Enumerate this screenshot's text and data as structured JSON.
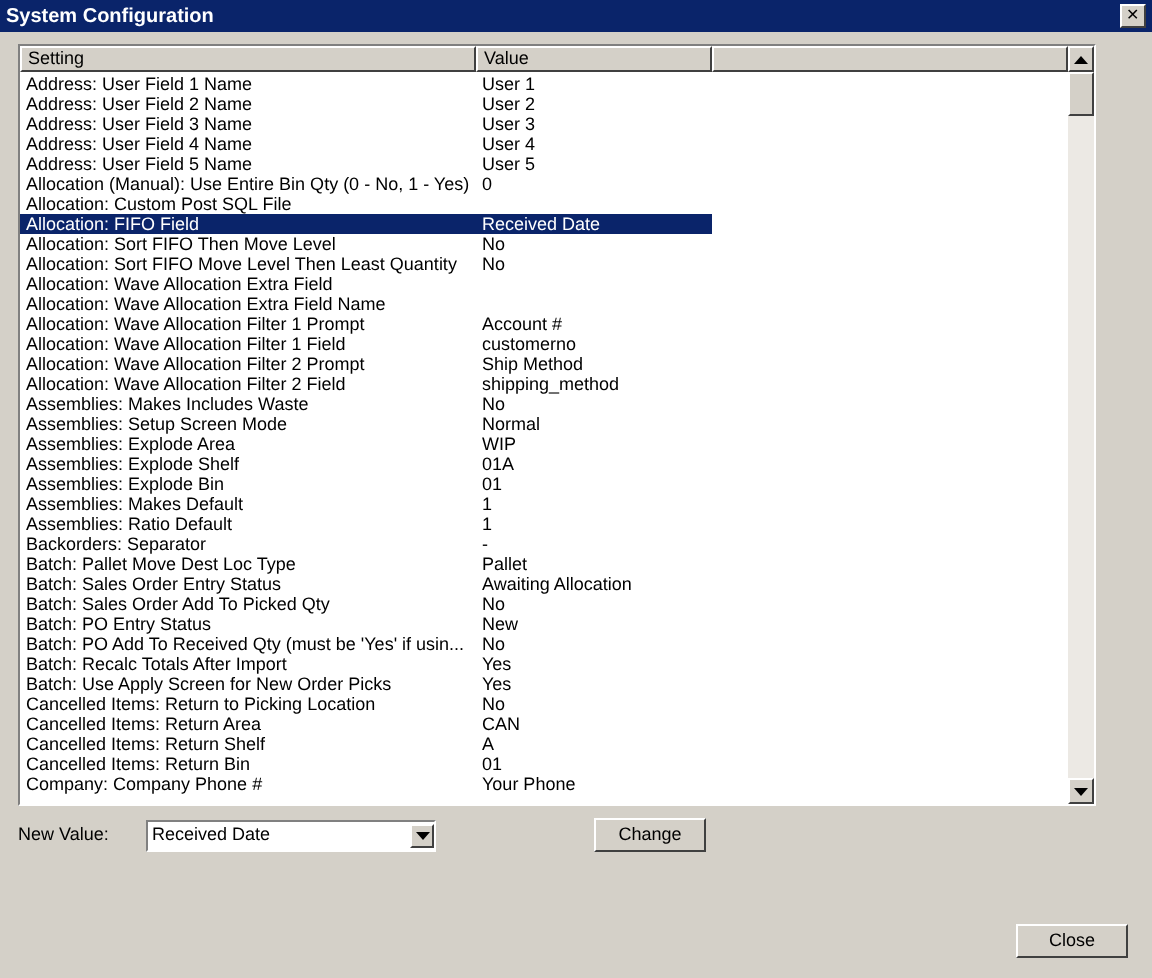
{
  "window": {
    "title": "System Configuration",
    "close": "✕"
  },
  "table": {
    "columns": [
      "Setting",
      "Value"
    ],
    "rows": [
      {
        "setting": "Address: User Field 1 Name",
        "value": "User 1",
        "selected": false
      },
      {
        "setting": "Address: User Field 2 Name",
        "value": "User 2",
        "selected": false
      },
      {
        "setting": "Address: User Field 3 Name",
        "value": "User 3",
        "selected": false
      },
      {
        "setting": "Address: User Field 4 Name",
        "value": "User 4",
        "selected": false
      },
      {
        "setting": "Address: User Field 5 Name",
        "value": "User 5",
        "selected": false
      },
      {
        "setting": "Allocation (Manual): Use Entire Bin Qty (0 - No, 1 - Yes)",
        "value": "0",
        "selected": false
      },
      {
        "setting": "Allocation: Custom Post SQL File",
        "selected": false
      },
      {
        "setting": "Allocation: FIFO Field",
        "value": "Received Date",
        "selected": true
      },
      {
        "setting": "Allocation: Sort FIFO Then Move Level",
        "value": "No",
        "selected": false
      },
      {
        "setting": "Allocation: Sort FIFO Move Level Then Least Quantity",
        "value": "No",
        "selected": false
      },
      {
        "setting": "Allocation: Wave Allocation Extra Field",
        "selected": false
      },
      {
        "setting": "Allocation: Wave Allocation Extra Field Name",
        "selected": false
      },
      {
        "setting": "Allocation: Wave Allocation Filter 1 Prompt",
        "value": "Account #",
        "selected": false
      },
      {
        "setting": "Allocation: Wave Allocation Filter 1 Field",
        "value": "customerno",
        "selected": false
      },
      {
        "setting": "Allocation: Wave Allocation Filter 2 Prompt",
        "value": "Ship Method",
        "selected": false
      },
      {
        "setting": "Allocation: Wave Allocation Filter 2 Field",
        "value": "shipping_method",
        "selected": false
      },
      {
        "setting": "Assemblies: Makes Includes Waste",
        "value": "No",
        "selected": false
      },
      {
        "setting": "Assemblies: Setup Screen Mode",
        "value": "Normal",
        "selected": false
      },
      {
        "setting": "Assemblies: Explode Area",
        "value": "WIP",
        "selected": false
      },
      {
        "setting": "Assemblies: Explode Shelf",
        "value": "01A",
        "selected": false
      },
      {
        "setting": "Assemblies: Explode Bin",
        "value": "01",
        "selected": false
      },
      {
        "setting": "Assemblies: Makes Default",
        "value": "1",
        "selected": false
      },
      {
        "setting": "Assemblies: Ratio Default",
        "value": "1",
        "selected": false
      },
      {
        "setting": "Backorders: Separator",
        "value": "-",
        "selected": false
      },
      {
        "setting": "Batch: Pallet Move Dest Loc Type",
        "value": "Pallet",
        "selected": false
      },
      {
        "setting": "Batch: Sales Order Entry Status",
        "value": "Awaiting Allocation",
        "selected": false
      },
      {
        "setting": "Batch: Sales Order Add To Picked Qty",
        "value": "No",
        "selected": false
      },
      {
        "setting": "Batch: PO Entry Status",
        "value": "New",
        "selected": false
      },
      {
        "setting": "Batch: PO Add To Received Qty (must be 'Yes' if usin...",
        "value": "No",
        "selected": false
      },
      {
        "setting": "Batch: Recalc Totals After Import",
        "value": "Yes",
        "selected": false
      },
      {
        "setting": "Batch: Use Apply Screen for New Order Picks",
        "value": "Yes",
        "selected": false
      },
      {
        "setting": "Cancelled Items: Return to Picking Location",
        "value": "No",
        "selected": false
      },
      {
        "setting": "Cancelled Items: Return Area",
        "value": "CAN",
        "selected": false
      },
      {
        "setting": "Cancelled Items: Return Shelf",
        "value": "A",
        "selected": false
      },
      {
        "setting": "Cancelled Items: Return Bin",
        "value": "01",
        "selected": false
      },
      {
        "setting": "Company: Company Phone #",
        "value": "Your Phone",
        "selected": false
      }
    ]
  },
  "new_value": {
    "label": "New Value:",
    "value": "Received Date"
  },
  "buttons": {
    "change": "Change",
    "close": "Close"
  }
}
